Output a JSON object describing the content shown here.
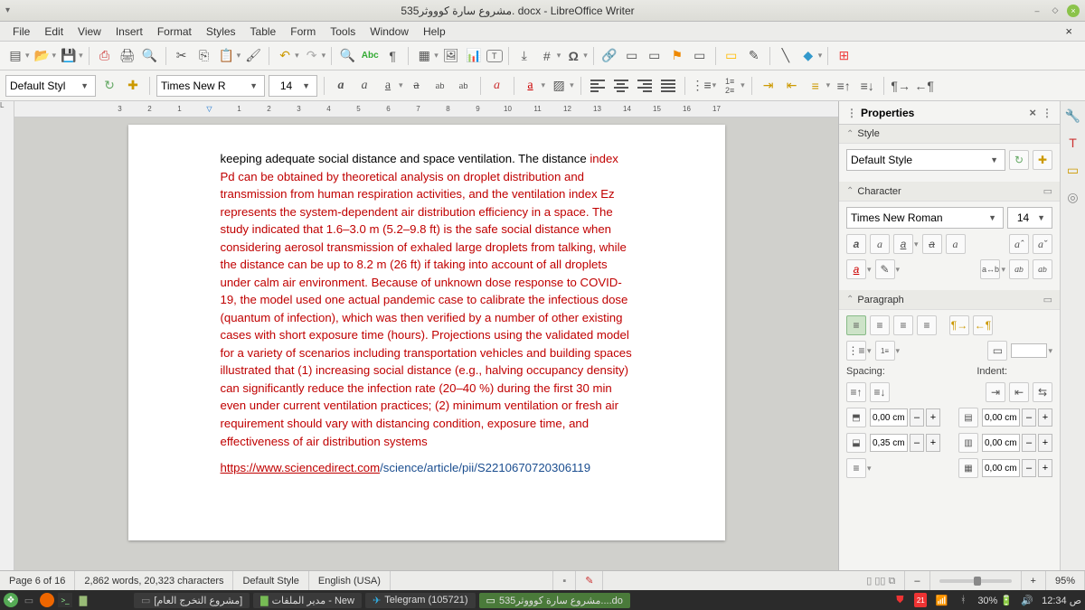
{
  "window": {
    "title": "5مشروع سارة كوووثر35. docx - LibreOffice Writer"
  },
  "menu": [
    "File",
    "Edit",
    "View",
    "Insert",
    "Format",
    "Styles",
    "Table",
    "Form",
    "Tools",
    "Window",
    "Help"
  ],
  "toolbar2": {
    "para_style": "Default Styl",
    "font_name": "Times New R",
    "font_size": "14"
  },
  "ruler": [
    "3",
    "2",
    "1",
    "",
    "1",
    "2",
    "3",
    "4",
    "5",
    "6",
    "7",
    "8",
    "9",
    "10",
    "11",
    "12",
    "13",
    "14",
    "15",
    "16",
    "17"
  ],
  "doc": {
    "p1": "keeping adequate social distance and space ventilation. The distance ",
    "p1b": "index Pd can be obtained by theoretical analysis on droplet distribution and transmission from human respiration activities, and the ventilation index Ez represents the system-dependent air distribution efficiency in a space. The study indicated that 1.6–3.0 m (5.2–9.8 ft) is the safe social distance when considering aerosol transmission of exhaled large droplets from talking, while the distance can be up to 8.2 m (26 ft) if taking into account of all droplets under calm air environment. Because of unknown dose response to COVID-19, the model used one actual pandemic case to calibrate the infectious dose (quantum of infection), which was then verified by a number of other existing cases with short exposure time (hours). Projections using the validated model for a variety of scenarios including transportation vehicles and building spaces illustrated that (1) increasing social distance (e.g., halving occupancy density) can significantly reduce the infection rate (20–40 %) during the first 30 min even under current ventilation practices; (2) minimum ventilation or fresh air requirement should vary with distancing condition, exposure time, and effectiveness of air distribution systems",
    "link_a": "https://www.sciencedirect.com",
    "link_b": "/science/article/pii/S2210670720306119"
  },
  "sidebar": {
    "title": "Properties",
    "style": {
      "label": "Style",
      "value": "Default Style"
    },
    "character": {
      "label": "Character",
      "font": "Times New Roman",
      "size": "14"
    },
    "paragraph": {
      "label": "Paragraph",
      "spacing_label": "Spacing:",
      "indent_label": "Indent:",
      "above": "0,00 cm",
      "below": "0,35 cm",
      "ind_before": "0,00 cm",
      "ind_after": "0,00 cm",
      "ind_first": "0,00 cm"
    }
  },
  "status": {
    "page": "Page 6 of 16",
    "words": "2,862 words, 20,323 characters",
    "style": "Default Style",
    "lang": "English (USA)",
    "zoom": "95%"
  },
  "taskbar": {
    "items": [
      {
        "label": "[مشروع التخرج العام]"
      },
      {
        "label": "مدير الملفات - New"
      },
      {
        "label": "Telegram (105721)"
      },
      {
        "label": "5مشروع سارة كوووثر35....do",
        "active": true
      }
    ],
    "battery": "30%",
    "clock": "ص 12:34"
  }
}
